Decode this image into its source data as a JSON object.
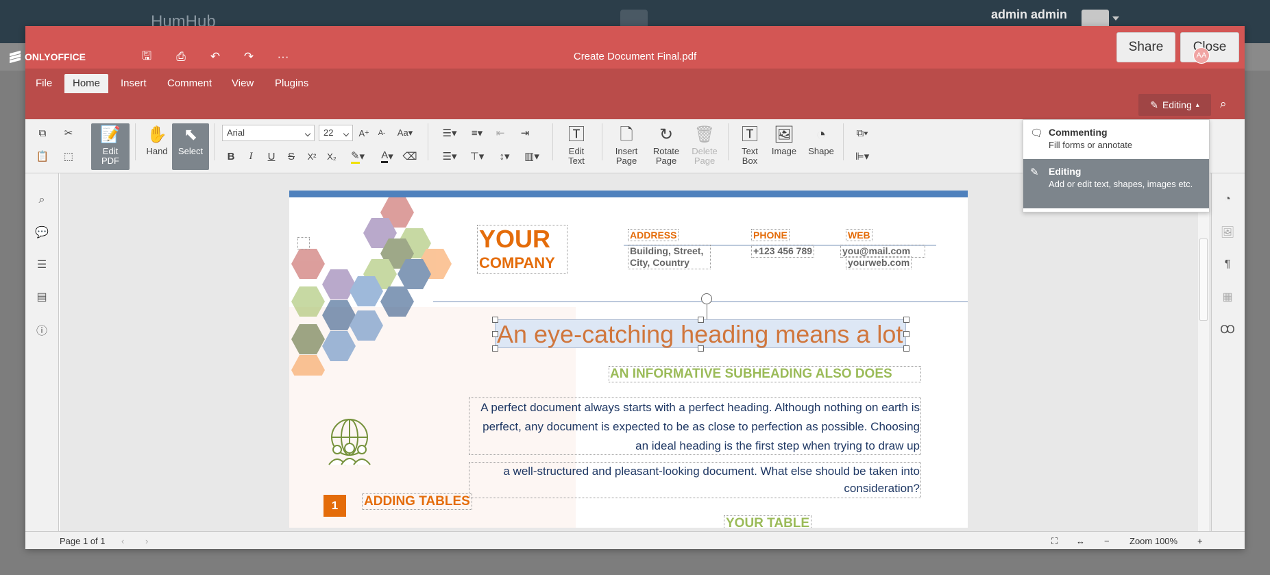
{
  "humhub": {
    "logo": "HumHub",
    "user_name": "admin admin"
  },
  "modal": {
    "share_label": "Share",
    "close_label": "Close"
  },
  "editor": {
    "brand": "ONLYOFFICE",
    "document_title": "Create Document Final.pdf",
    "user_initials": "AA",
    "mode_label": "Editing",
    "tabs": [
      {
        "label": "File"
      },
      {
        "label": "Home"
      },
      {
        "label": "Insert"
      },
      {
        "label": "Comment"
      },
      {
        "label": "View"
      },
      {
        "label": "Plugins"
      }
    ],
    "toolbar": {
      "edit_pdf": "Edit PDF",
      "hand": "Hand",
      "select": "Select",
      "font_name": "Arial",
      "font_size": "22",
      "edit_text": "Edit Text",
      "insert_page": "Insert Page",
      "rotate_page": "Rotate Page",
      "delete_page": "Delete Page",
      "text_box": "Text Box",
      "image": "Image",
      "shape": "Shape"
    },
    "mode_menu": [
      {
        "title": "Commenting",
        "desc": "Fill forms or annotate"
      },
      {
        "title": "Editing",
        "desc": "Add or edit text, shapes, images etc."
      }
    ],
    "status": {
      "page_info": "Page 1 of 1",
      "zoom": "Zoom 100%"
    }
  },
  "document": {
    "company_l1": "YOUR",
    "company_l2": "COMPANY",
    "address_label": "ADDRESS",
    "address_value": "Building, Street, City, Country",
    "phone_label": "PHONE",
    "phone_value": "+123 456 789",
    "web_label": "WEB",
    "web_email": "you@mail.com",
    "web_url": "yourweb.com",
    "heading": "An eye-catching heading means a lot",
    "subheading": "AN INFORMATIVE SUBHEADING ALSO DOES",
    "para1": "A perfect document always starts with a perfect heading. Although nothing on earth is perfect, any document is expected to be as close to perfection as possible. Choosing an ideal heading is the first step when trying to draw up",
    "para2": "a well-structured and pleasant-looking document. What else should be taken into consideration?",
    "section_number": "1",
    "section_title": "ADDING TABLES",
    "table_title": "YOUR TABLE"
  }
}
